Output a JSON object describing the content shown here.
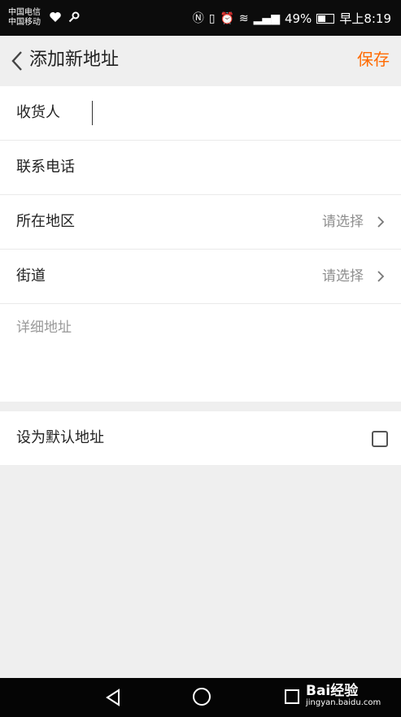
{
  "statusbar": {
    "carrier1": "中国电信",
    "carrier2": "中国移动",
    "battery": "49%",
    "time": "早上8:19",
    "icons": [
      "heart-icon",
      "key-icon",
      "nfc-icon",
      "vibrate-icon",
      "alarm-icon",
      "wifi-icon",
      "signal-icon"
    ]
  },
  "header": {
    "title": "添加新地址",
    "save_label": "保存"
  },
  "form": {
    "name_label": "收货人",
    "phone_label": "联系电话",
    "region_label": "所在地区",
    "region_value": "请选择",
    "street_label": "街道",
    "street_value": "请选择",
    "detail_placeholder": "详细地址"
  },
  "default_row": {
    "label": "设为默认地址",
    "checked": false
  },
  "watermark": {
    "logo": "Bai经验",
    "url": "jingyan.baidu.com"
  },
  "colors": {
    "accent": "#ff6a00",
    "background": "#efefef",
    "statusbar": "#0c0c0c"
  }
}
